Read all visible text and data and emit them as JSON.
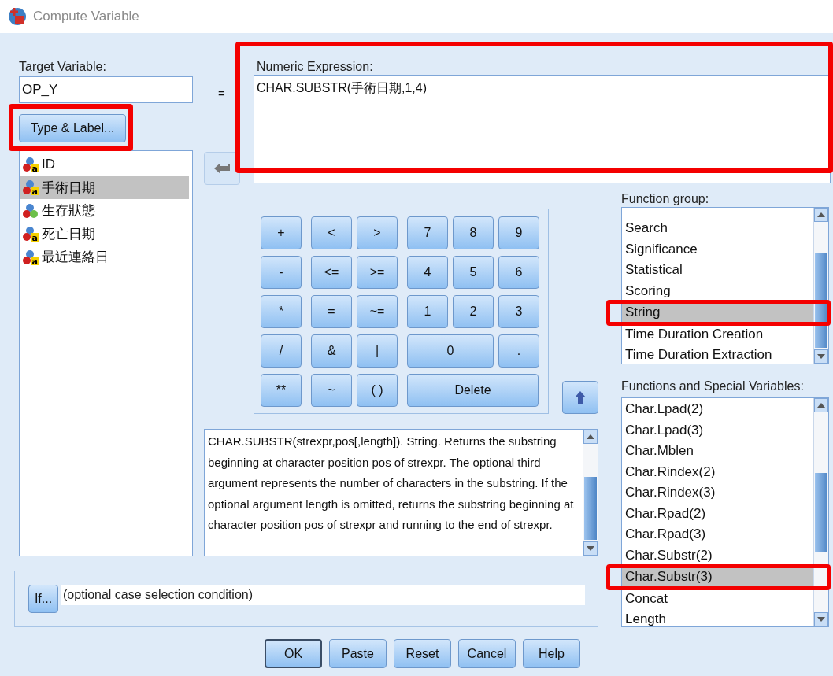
{
  "window": {
    "title": "Compute Variable"
  },
  "target": {
    "label": "Target Variable:",
    "value": "OP_Y",
    "type_button": {
      "label": "Type & Label...",
      "highlight": true
    }
  },
  "equals": "=",
  "expression": {
    "label": "Numeric Expression:",
    "value": "CHAR.SUBSTR(手術日期,1,4)",
    "highlight": true
  },
  "variables": [
    {
      "name": "ID",
      "kind": "string",
      "icon_text": "a",
      "selected": false
    },
    {
      "name": "手術日期",
      "kind": "string",
      "icon_text": "a",
      "selected": true
    },
    {
      "name": "生存狀態",
      "kind": "nominal",
      "selected": false
    },
    {
      "name": "死亡日期",
      "kind": "string",
      "icon_text": "a",
      "selected": false
    },
    {
      "name": "最近連絡日",
      "kind": "string",
      "icon_text": "a",
      "selected": false
    }
  ],
  "keypad": [
    [
      {
        "label": "+",
        "kind": "single"
      },
      {
        "label": "<",
        "kind": "single"
      },
      {
        "label": ">",
        "kind": "single"
      },
      {
        "label": "7",
        "kind": "single"
      },
      {
        "label": "8",
        "kind": "single"
      },
      {
        "label": "9",
        "kind": "single"
      }
    ],
    [
      {
        "label": "-",
        "kind": "single"
      },
      {
        "label": "<=",
        "kind": "single"
      },
      {
        "label": ">=",
        "kind": "single"
      },
      {
        "label": "4",
        "kind": "single"
      },
      {
        "label": "5",
        "kind": "single"
      },
      {
        "label": "6",
        "kind": "single"
      }
    ],
    [
      {
        "label": "*",
        "kind": "single"
      },
      {
        "label": "=",
        "kind": "single"
      },
      {
        "label": "~=",
        "kind": "single"
      },
      {
        "label": "1",
        "kind": "single"
      },
      {
        "label": "2",
        "kind": "single"
      },
      {
        "label": "3",
        "kind": "single"
      }
    ],
    [
      {
        "label": "/",
        "kind": "single"
      },
      {
        "label": "&",
        "kind": "single"
      },
      {
        "label": "|",
        "kind": "single"
      },
      {
        "label": "0",
        "kind": "double"
      },
      {
        "label": ".",
        "kind": "single"
      }
    ],
    [
      {
        "label": "**",
        "kind": "single"
      },
      {
        "label": "~",
        "kind": "single"
      },
      {
        "label": "( )",
        "kind": "single"
      },
      {
        "label": "Delete",
        "kind": "triple"
      }
    ]
  ],
  "description": "CHAR.SUBSTR(strexpr,pos[,length]). String. Returns the substring beginning at character position pos of strexpr. The optional third argument represents the number of characters in the substring. If the optional argument length is omitted, returns the substring beginning at character position pos of strexpr and running to the end of strexpr.",
  "function_group": {
    "label": "Function group:",
    "items": [
      {
        "name": "Search",
        "selected": false,
        "highlight": false
      },
      {
        "name": "Significance",
        "selected": false,
        "highlight": false
      },
      {
        "name": "Statistical",
        "selected": false,
        "highlight": false
      },
      {
        "name": "Scoring",
        "selected": false,
        "highlight": false
      },
      {
        "name": "String",
        "selected": true,
        "highlight": true
      },
      {
        "name": "Time Duration Creation",
        "selected": false,
        "highlight": false
      },
      {
        "name": "Time Duration Extraction",
        "selected": false,
        "highlight": false
      }
    ]
  },
  "functions": {
    "label": "Functions and Special Variables:",
    "items": [
      {
        "name": "Char.Lpad(2)",
        "selected": false,
        "highlight": false
      },
      {
        "name": "Char.Lpad(3)",
        "selected": false,
        "highlight": false
      },
      {
        "name": "Char.Mblen",
        "selected": false,
        "highlight": false
      },
      {
        "name": "Char.Rindex(2)",
        "selected": false,
        "highlight": false
      },
      {
        "name": "Char.Rindex(3)",
        "selected": false,
        "highlight": false
      },
      {
        "name": "Char.Rpad(2)",
        "selected": false,
        "highlight": false
      },
      {
        "name": "Char.Rpad(3)",
        "selected": false,
        "highlight": false
      },
      {
        "name": "Char.Substr(2)",
        "selected": false,
        "highlight": false
      },
      {
        "name": "Char.Substr(3)",
        "selected": true,
        "highlight": true
      },
      {
        "name": "Concat",
        "selected": false,
        "highlight": false
      },
      {
        "name": "Length",
        "selected": false,
        "highlight": false
      }
    ]
  },
  "condition": {
    "button": "If...",
    "placeholder": "(optional case selection condition)"
  },
  "buttons": [
    {
      "label": "OK",
      "default": true
    },
    {
      "label": "Paste",
      "default": false
    },
    {
      "label": "Reset",
      "default": false
    },
    {
      "label": "Cancel",
      "default": false
    },
    {
      "label": "Help",
      "default": false
    }
  ]
}
